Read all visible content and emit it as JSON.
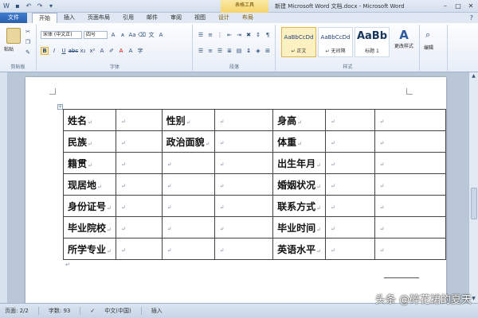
{
  "window": {
    "title": "新建 Microsoft Word 文档.docx - Microsoft Word",
    "contextual_tab": "表格工具"
  },
  "tabs": [
    {
      "label": "文件"
    },
    {
      "label": "开始"
    },
    {
      "label": "插入"
    },
    {
      "label": "页面布局"
    },
    {
      "label": "引用"
    },
    {
      "label": "邮件"
    },
    {
      "label": "审阅"
    },
    {
      "label": "视图"
    },
    {
      "label": "设计"
    },
    {
      "label": "布局"
    }
  ],
  "ribbon": {
    "clipboard": {
      "paste_label": "粘贴",
      "group_label": "剪贴板"
    },
    "font": {
      "font_name": "宋体 (中文正)",
      "font_size": "四号",
      "group_label": "字体"
    },
    "paragraph": {
      "group_label": "段落"
    },
    "styles": {
      "items": [
        {
          "sample": "AaBbCcDd",
          "name": "↵ 正文"
        },
        {
          "sample": "AaBbCcDd",
          "name": "↵ 无间隔"
        },
        {
          "sample": "AaBb",
          "name": "标题 1"
        }
      ],
      "change_label": "更改样式",
      "group_label": "样式"
    },
    "editing": {
      "label": "编辑"
    }
  },
  "table": {
    "rows": [
      [
        "姓名",
        "",
        "性别",
        "",
        "身高",
        "",
        ""
      ],
      [
        "民族",
        "",
        "政治面貌",
        "",
        "体重",
        "",
        ""
      ],
      [
        "籍贯",
        "",
        "",
        "",
        "出生年月",
        "",
        ""
      ],
      [
        "现居地",
        "",
        "",
        "",
        "婚姻状况",
        "",
        ""
      ],
      [
        "身份证号",
        "",
        "",
        "",
        "联系方式",
        "",
        ""
      ],
      [
        "毕业院校",
        "",
        "",
        "",
        "毕业时间",
        "",
        ""
      ],
      [
        "所学专业",
        "",
        "",
        "",
        "英语水平",
        "",
        ""
      ]
    ]
  },
  "status": {
    "page": "页面: 2/2",
    "words": "字数: 93",
    "language": "中文(中国)",
    "mode": "插入"
  },
  "watermark": "头条 @碎花裙的夏天"
}
